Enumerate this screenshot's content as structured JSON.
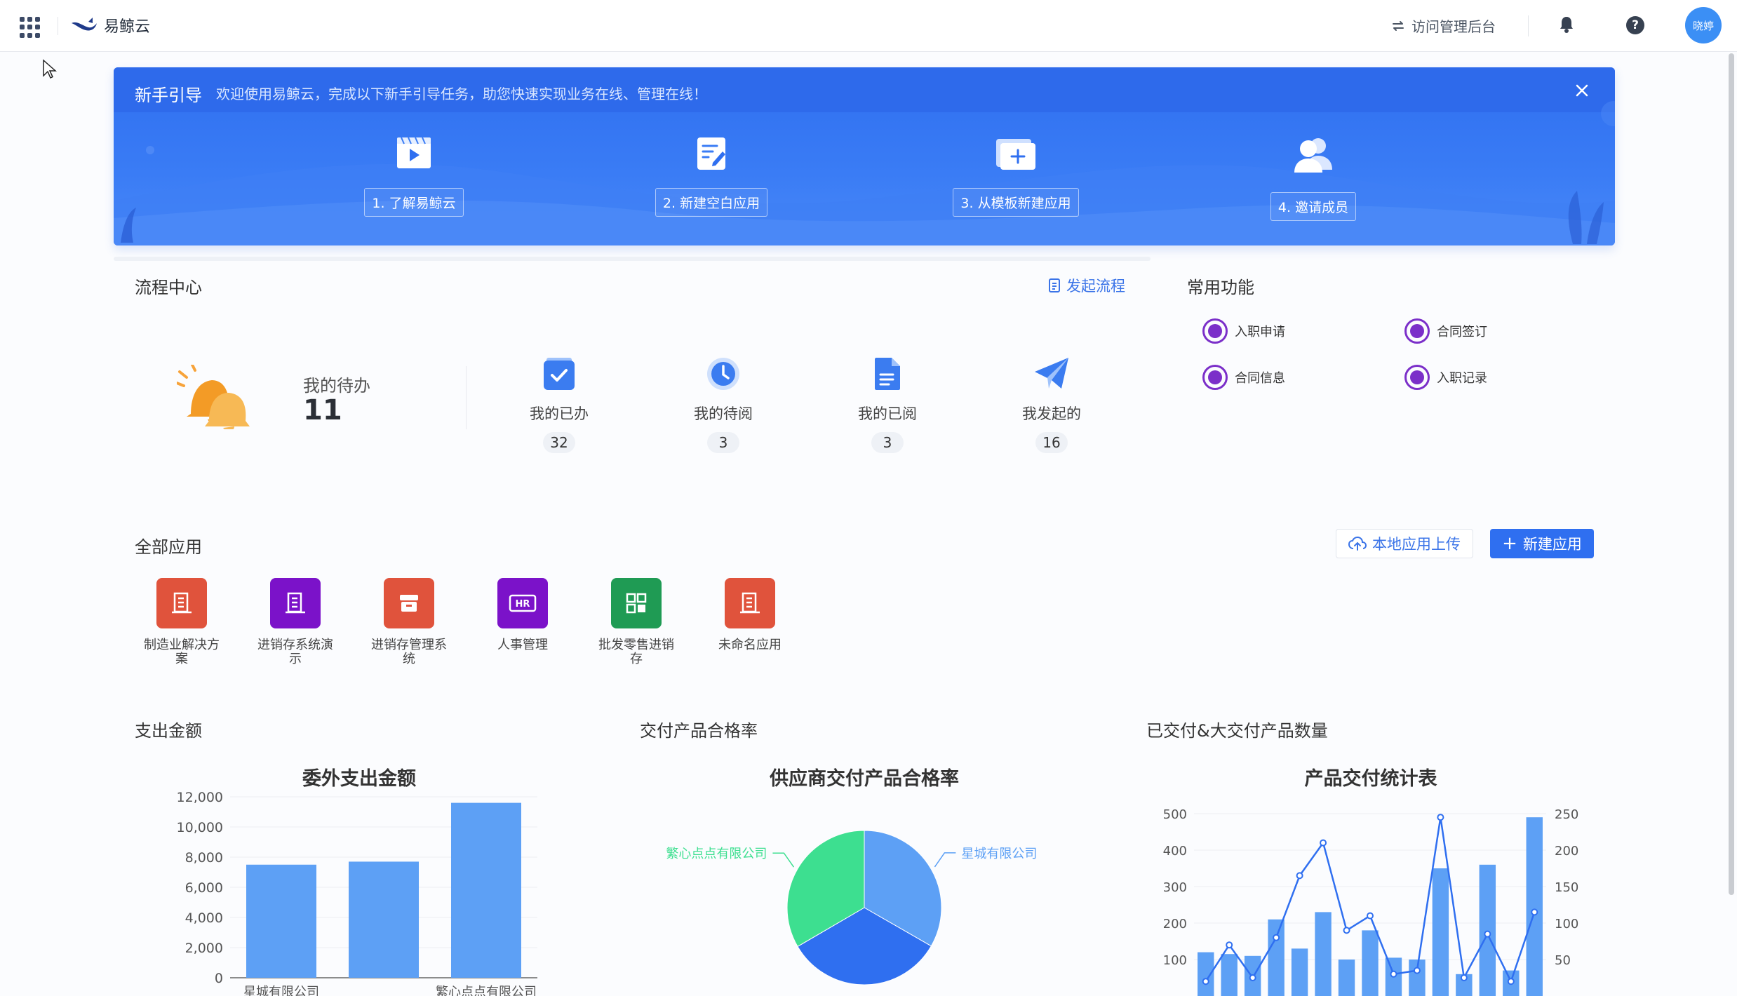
{
  "header": {
    "brand": "易鲸云",
    "visit_admin": "访问管理后台",
    "avatar_text": "晓婷"
  },
  "guide": {
    "title": "新手引导",
    "description": "欢迎使用易鲸云，完成以下新手引导任务，助您快速实现业务在线、管理在线！",
    "steps": [
      {
        "label": "1. 了解易鲸云",
        "icon": "video-play-icon"
      },
      {
        "label": "2. 新建空白应用",
        "icon": "edit-document-icon"
      },
      {
        "label": "3. 从模板新建应用",
        "icon": "template-add-icon"
      },
      {
        "label": "4. 邀请成员",
        "icon": "invite-users-icon"
      }
    ]
  },
  "process": {
    "title": "流程中心",
    "start_flow": "发起流程",
    "todo_label": "我的待办",
    "todo_count": "11",
    "stats": [
      {
        "label": "我的已办",
        "count": "32",
        "icon": "check-square-icon"
      },
      {
        "label": "我的待阅",
        "count": "3",
        "icon": "clock-icon"
      },
      {
        "label": "我的已阅",
        "count": "3",
        "icon": "document-icon"
      },
      {
        "label": "我发起的",
        "count": "16",
        "icon": "paper-plane-icon"
      }
    ]
  },
  "common": {
    "title": "常用功能",
    "items": [
      {
        "label": "入职申请"
      },
      {
        "label": "合同签订"
      },
      {
        "label": "合同信息"
      },
      {
        "label": "入职记录"
      }
    ]
  },
  "apps": {
    "title": "全部应用",
    "upload": "本地应用上传",
    "new_app": "新建应用",
    "items": [
      {
        "name": "制造业解决方案",
        "color": "#e0533c"
      },
      {
        "name": "进销存系统演示",
        "color": "#7b12c9"
      },
      {
        "name": "进销存管理系统",
        "color": "#e0533c"
      },
      {
        "name": "人事管理",
        "color": "#7b12c9",
        "badge": "HR"
      },
      {
        "name": "批发零售进销存",
        "color": "#1f9b54"
      },
      {
        "name": "未命名应用",
        "color": "#e0533c"
      }
    ]
  },
  "chart_sections": {
    "c1": "支出金额",
    "c2": "交付产品合格率",
    "c3": "已交付&大交付产品数量"
  },
  "chart_data": [
    {
      "type": "bar",
      "title": "委外支出金额",
      "categories": [
        "星城有限公司",
        "",
        "繁心点点有限公司"
      ],
      "values": [
        7500,
        7700,
        11600
      ],
      "yticks": [
        "0",
        "2,000",
        "4,000",
        "6,000",
        "8,000",
        "10,000",
        "12,000"
      ],
      "ylim": [
        0,
        12000
      ],
      "color": "#5da0f5"
    },
    {
      "type": "pie",
      "title": "供应商交付产品合格率",
      "slices": [
        {
          "name": "星城有限公司",
          "value": 33.3,
          "color": "#5da0f5"
        },
        {
          "name": "",
          "value": 33.3,
          "color": "#2f6ff0"
        },
        {
          "name": "繁心点点有限公司",
          "value": 33.4,
          "color": "#3ddf90"
        }
      ]
    },
    {
      "type": "bar-line",
      "title": "产品交付统计表",
      "yticks_left": [
        "100",
        "200",
        "300",
        "400",
        "500"
      ],
      "ylim_left": [
        0,
        500
      ],
      "yticks_right": [
        "50",
        "100",
        "150",
        "200",
        "250"
      ],
      "ylim_right": [
        0,
        250
      ],
      "bars": [
        120,
        115,
        110,
        210,
        130,
        230,
        100,
        180,
        105,
        100,
        350,
        60,
        360,
        70,
        490
      ],
      "line": [
        20,
        70,
        25,
        80,
        165,
        210,
        90,
        110,
        30,
        35,
        245,
        25,
        85,
        20,
        115
      ],
      "bar_color": "#5da0f5",
      "line_color": "#2f6ff0"
    }
  ]
}
